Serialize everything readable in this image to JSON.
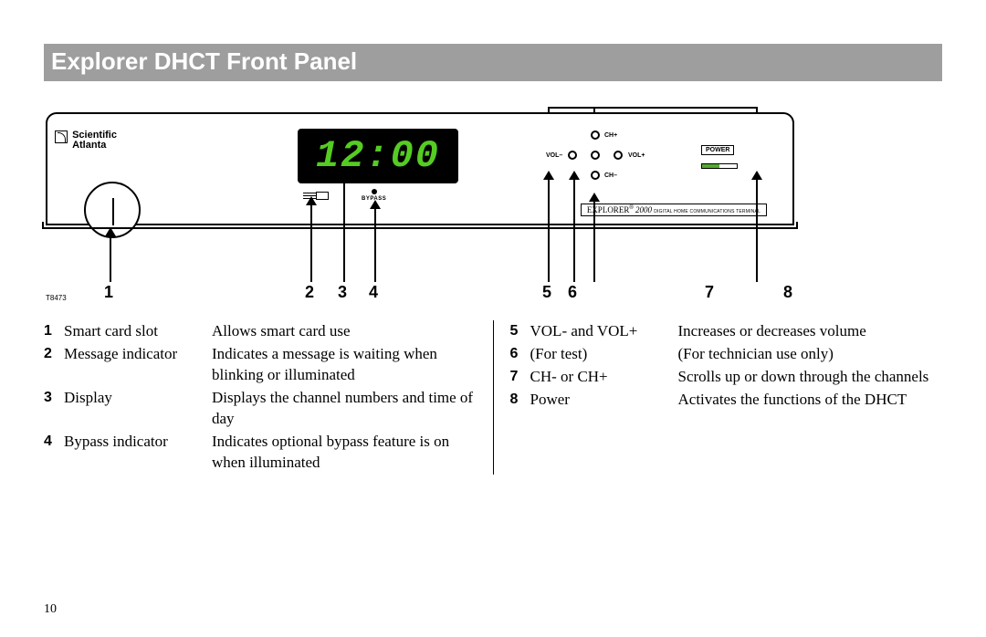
{
  "section_title": "Explorer DHCT Front Panel",
  "page_number": "10",
  "diagram": {
    "t_code": "T8473",
    "brand_line1": "Scientific",
    "brand_line2": "Atlanta",
    "display_time": "12:00",
    "bypass_label": "BYPASS",
    "nav": {
      "ch_plus": "CH+",
      "ch_minus": "CH–",
      "vol_plus": "VOL+",
      "vol_minus": "VOL–"
    },
    "power_label": "POWER",
    "model_prefix": "EXPLORER",
    "model_reg": "®",
    "model_num": "2000",
    "model_tag": "DIGITAL HOME COMMUNICATIONS TERMINAL",
    "callouts": [
      "1",
      "2",
      "3",
      "4",
      "5",
      "6",
      "7",
      "8"
    ]
  },
  "legend": {
    "left": [
      {
        "n": "1",
        "name": "Smart card slot",
        "desc": "Allows smart card use"
      },
      {
        "n": "2",
        "name": "Message indicator",
        "desc": "Indicates a message is waiting when blinking or illuminated"
      },
      {
        "n": "3",
        "name": "Display",
        "desc": "Displays the channel numbers and time of day"
      },
      {
        "n": "4",
        "name": "Bypass indicator",
        "desc": "Indicates optional bypass feature is on when illuminated"
      }
    ],
    "right": [
      {
        "n": "5",
        "name": "VOL- and VOL+",
        "desc": "Increases or decreases volume"
      },
      {
        "n": "6",
        "name": "(For test)",
        "desc": "(For technician use only)"
      },
      {
        "n": "7",
        "name": "CH- or CH+",
        "desc": "Scrolls up or down through the channels"
      },
      {
        "n": "8",
        "name": "Power",
        "desc": "Activates the functions of the DHCT"
      }
    ]
  }
}
